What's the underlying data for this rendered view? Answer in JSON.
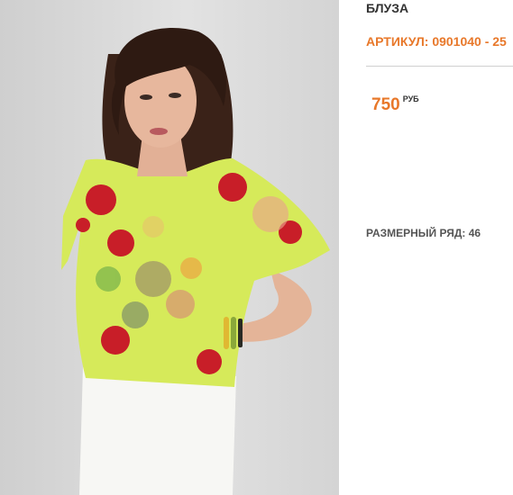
{
  "product": {
    "name": "БЛУЗА",
    "sku": "АРТИКУЛ: 0901040 - 25",
    "price": "750",
    "currency": "РУБ",
    "sizes": "РАЗМЕРНЫЙ РЯД: 46"
  },
  "photo": {
    "icon": "product-photo",
    "colors": {
      "backdrop": "#dcdcdc",
      "blouse": "#d6ea5a",
      "flowers": "#c81e28",
      "hair": "#2e1a12",
      "skin": "#e7b79d",
      "trousers": "#f7f7f4"
    }
  },
  "colors": {
    "accent": "#e8782a",
    "text": "#333333",
    "divider": "#cfcfcf"
  }
}
